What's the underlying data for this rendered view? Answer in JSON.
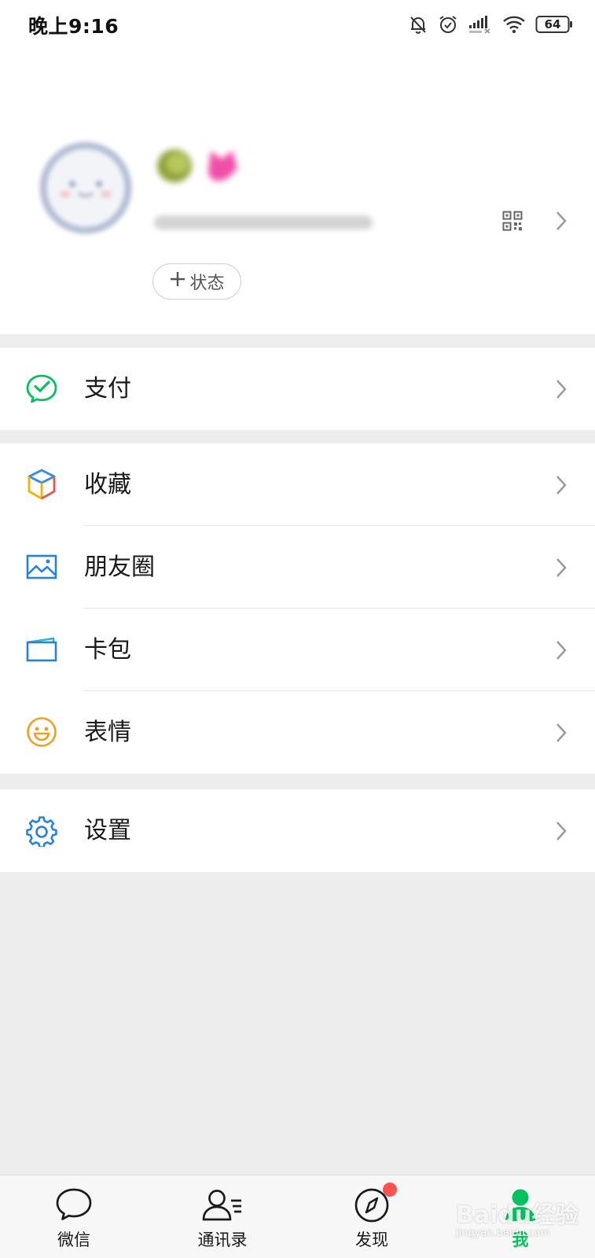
{
  "status_bar": {
    "time": "晚上9:16",
    "battery": "64",
    "icons": [
      "bell-muted-icon",
      "alarm-icon",
      "signal-icon",
      "wifi-icon",
      "battery-icon"
    ]
  },
  "profile": {
    "status_button_label": "状态",
    "icons": [
      "avatar",
      "qr-code-icon",
      "chevron-right-icon"
    ]
  },
  "menu": {
    "group1": [
      {
        "label": "支付",
        "icon": "wechat-pay-icon",
        "color": "#07c160"
      }
    ],
    "group2": [
      {
        "label": "收藏",
        "icon": "favorites-cube-icon",
        "color": "#f0b400"
      },
      {
        "label": "朋友圈",
        "icon": "moments-image-icon",
        "color": "#2782d7"
      },
      {
        "label": "卡包",
        "icon": "card-wallet-icon",
        "color": "#2782d7"
      },
      {
        "label": "表情",
        "icon": "sticker-smile-icon",
        "color": "#f0a01e"
      }
    ],
    "group3": [
      {
        "label": "设置",
        "icon": "settings-gear-icon",
        "color": "#2782d7"
      }
    ]
  },
  "tabs": [
    {
      "label": "微信",
      "icon": "chat-bubble-icon",
      "active": false
    },
    {
      "label": "通讯录",
      "icon": "contacts-icon",
      "active": false
    },
    {
      "label": "发现",
      "icon": "compass-icon",
      "active": false,
      "badge": true
    },
    {
      "label": "我",
      "icon": "me-person-icon",
      "active": true
    }
  ],
  "colors": {
    "accent": "#07c160",
    "badge": "#fa5151",
    "background": "#ededed"
  },
  "watermark": {
    "brand": "Baidu经验",
    "url": "jingyan.baidu.com"
  }
}
